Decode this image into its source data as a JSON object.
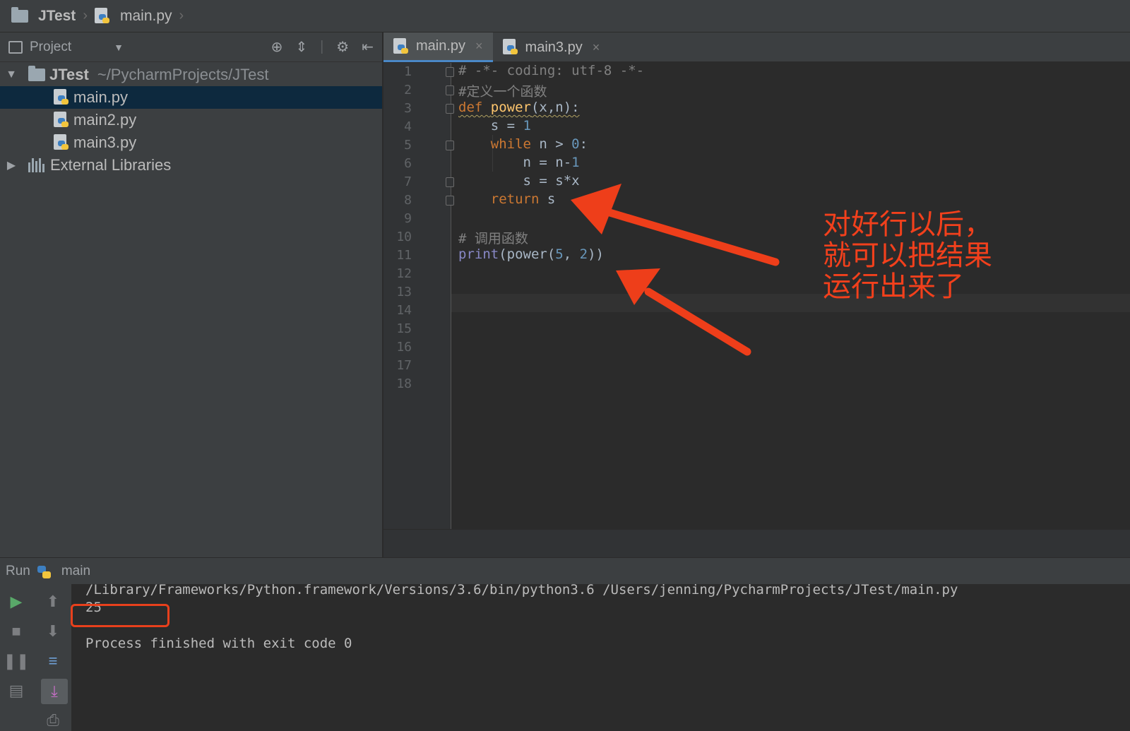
{
  "breadcrumb": {
    "project": "JTest",
    "file": "main.py"
  },
  "project_panel": {
    "title": "Project",
    "root": {
      "name": "JTest",
      "path": "~/PycharmProjects/JTest"
    },
    "files": [
      "main.py",
      "main2.py",
      "main3.py"
    ],
    "selected_file": "main.py",
    "libraries": "External Libraries"
  },
  "tabs": [
    {
      "label": "main.py",
      "active": true
    },
    {
      "label": "main3.py",
      "active": false
    }
  ],
  "editor": {
    "line_numbers": [
      "1",
      "2",
      "3",
      "4",
      "5",
      "6",
      "7",
      "8",
      "9",
      "10",
      "11",
      "12",
      "13",
      "14",
      "15",
      "16",
      "17",
      "18"
    ],
    "code": {
      "l1": "# -*- coding: utf-8 -*-",
      "l2": "#定义一个函数",
      "l3_kw": "def",
      "l3_fn": "power",
      "l3_rest": "(x,n):",
      "l4_a": "s = ",
      "l4_num": "1",
      "l5_kw": "while",
      "l5_a": " n > ",
      "l5_num": "0",
      "l5_b": ":",
      "l6_a": "n = n-",
      "l6_num": "1",
      "l7": "s = s*x",
      "l8_kw": "return",
      "l8_a": " s",
      "l10": "# 调用函数",
      "l11_builtin": "print",
      "l11_a": "(power(",
      "l11_n1": "5",
      "l11_b": ", ",
      "l11_n2": "2",
      "l11_c": "))"
    }
  },
  "annotation": {
    "text": "对好行以后，\n就可以把结果\n运行出来了",
    "color": "#f2401c"
  },
  "run_panel": {
    "label": "Run",
    "config": "main",
    "command": "/Library/Frameworks/Python.framework/Versions/3.6/bin/python3.6 /Users/jenning/PycharmProjects/JTest/main.py",
    "output": "25",
    "exit_message": "Process finished with exit code 0"
  },
  "icons": {
    "run": "play-icon",
    "stop": "stop-icon",
    "pause": "pause-icon",
    "rerun_up": "arrow-up-icon",
    "rerun_down": "arrow-down-icon",
    "soft_wrap": "soft-wrap-icon",
    "layout": "layout-icon",
    "scroll": "scroll-to-end-icon",
    "print": "print-icon"
  }
}
